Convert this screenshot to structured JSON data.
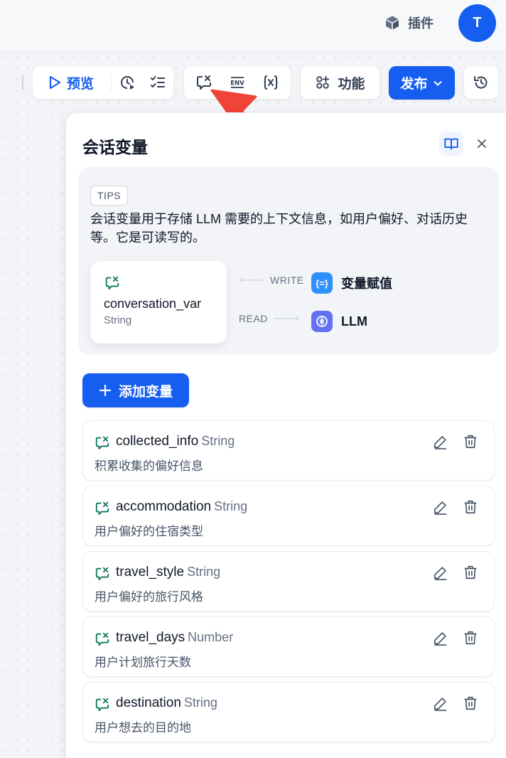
{
  "topbar": {
    "plugin_label": "插件",
    "avatar_initial": "T"
  },
  "toolbar": {
    "preview_label": "预览",
    "features_label": "功能",
    "publish_label": "发布"
  },
  "panel": {
    "title": "会话变量",
    "tips": {
      "badge": "TIPS",
      "text": "会话变量用于存储 LLM 需要的上下文信息，如用户偏好、对话历史等。它是可读写的。",
      "example_var_name": "conversation_var",
      "example_var_type": "String",
      "write_label": "WRITE",
      "read_label": "READ",
      "assign_node_icon": "{=}",
      "assign_node_label": "变量赋值",
      "llm_node_label": "LLM"
    },
    "add_button_label": "添加变量",
    "variables": [
      {
        "name": "collected_info",
        "type": "String",
        "description": "积累收集的偏好信息"
      },
      {
        "name": "accommodation",
        "type": "String",
        "description": "用户偏好的住宿类型"
      },
      {
        "name": "travel_style",
        "type": "String",
        "description": "用户偏好的旅行风格"
      },
      {
        "name": "travel_days",
        "type": "Number",
        "description": "用户计划旅行天数"
      },
      {
        "name": "destination",
        "type": "String",
        "description": "用户想去的目的地"
      }
    ]
  },
  "colors": {
    "primary": "#155eef",
    "var_icon": "#0e7a5f",
    "arrow": "#f04438",
    "llm_node": "#6172f3",
    "assign_node": "#2e90fa"
  }
}
